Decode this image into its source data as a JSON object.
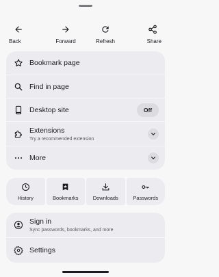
{
  "nav": {
    "back_label": "Back",
    "forward_label": "Forward",
    "refresh_label": "Refresh",
    "share_label": "Share"
  },
  "menu": {
    "bookmark_page": "Bookmark page",
    "find_in_page": "Find in page",
    "desktop_site": "Desktop site",
    "desktop_site_toggle": "Off",
    "extensions": "Extensions",
    "extensions_sub": "Try a recommended extension",
    "more": "More"
  },
  "tiles": {
    "history": "History",
    "bookmarks": "Bookmarks",
    "downloads": "Downloads",
    "passwords": "Passwords"
  },
  "account": {
    "sign_in": "Sign in",
    "sign_in_sub": "Sync passwords, bookmarks, and more",
    "settings": "Settings"
  },
  "colors": {
    "background": "#f7f7f8",
    "card": "#ececf0",
    "pill": "#dcdce0",
    "text": "#1b1b1f"
  }
}
